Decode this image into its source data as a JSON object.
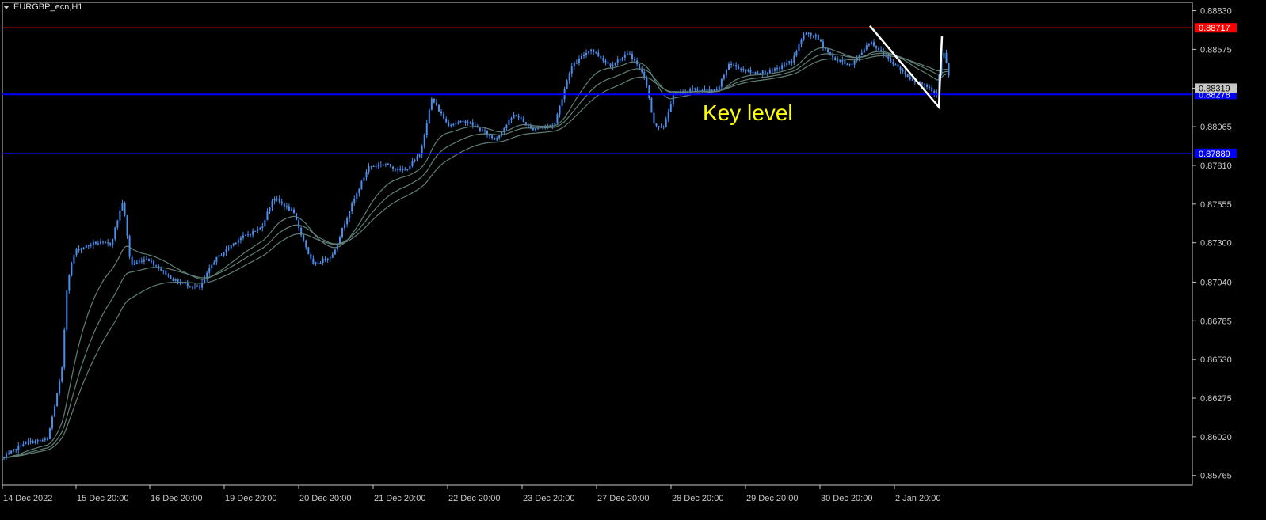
{
  "window": {
    "symbol_title": "EURGBP_ecn,H1"
  },
  "colors": {
    "background": "#000000",
    "axis": "#c8c8c8",
    "candle": "#4a8ef0",
    "ma": "#5f7f78",
    "resistance": "#ff0000",
    "key_level": "#0000ff",
    "support": "#0000ff",
    "annotation": "#ffff00",
    "trend_line": "#ffffff"
  },
  "chart_data": {
    "type": "candlestick",
    "symbol": "EURGBP_ecn",
    "timeframe": "H1",
    "y_range": [
      0.85701,
      0.88885
    ],
    "price_ticks": [
      "0.88830",
      "0.88575",
      "0.88319",
      "0.88065",
      "0.87810",
      "0.87555",
      "0.87300",
      "0.87040",
      "0.86785",
      "0.86530",
      "0.86275",
      "0.86020",
      "0.85765"
    ],
    "time_labels": [
      "14 Dec 2022",
      "15 Dec 20:00",
      "16 Dec 20:00",
      "19 Dec 20:00",
      "20 Dec 20:00",
      "21 Dec 20:00",
      "22 Dec 20:00",
      "23 Dec 20:00",
      "27 Dec 20:00",
      "28 Dec 20:00",
      "29 Dec 20:00",
      "30 Dec 20:00",
      "2 Jan 20:00"
    ],
    "horizontal_lines": [
      {
        "name": "resistance",
        "price": 0.88717,
        "label": "0.88717",
        "color": "#ff0000"
      },
      {
        "name": "key-level",
        "price": 0.88278,
        "label": "0.88278",
        "color": "#0000ff"
      },
      {
        "name": "support",
        "price": 0.87889,
        "label": "0.87889",
        "color": "#0000ff"
      }
    ],
    "current_price": {
      "price": 0.88319,
      "label": "0.88319"
    },
    "annotation": {
      "text": "Key level",
      "price": 0.8815
    },
    "trend_line": {
      "from_price": 0.8873,
      "to_price": 0.88195,
      "return_price": 0.8866
    },
    "price_path": [
      {
        "x": 0,
        "y": 0.8586
      },
      {
        "x": 30,
        "y": 0.8598
      },
      {
        "x": 60,
        "y": 0.86
      },
      {
        "x": 78,
        "y": 0.8645
      },
      {
        "x": 85,
        "y": 0.8705
      },
      {
        "x": 95,
        "y": 0.8725
      },
      {
        "x": 120,
        "y": 0.873
      },
      {
        "x": 140,
        "y": 0.8729
      },
      {
        "x": 155,
        "y": 0.8758
      },
      {
        "x": 165,
        "y": 0.8715
      },
      {
        "x": 185,
        "y": 0.872
      },
      {
        "x": 220,
        "y": 0.8705
      },
      {
        "x": 252,
        "y": 0.87
      },
      {
        "x": 270,
        "y": 0.8718
      },
      {
        "x": 300,
        "y": 0.8732
      },
      {
        "x": 330,
        "y": 0.874
      },
      {
        "x": 345,
        "y": 0.876
      },
      {
        "x": 370,
        "y": 0.875
      },
      {
        "x": 395,
        "y": 0.8715
      },
      {
        "x": 420,
        "y": 0.8722
      },
      {
        "x": 440,
        "y": 0.875
      },
      {
        "x": 465,
        "y": 0.878
      },
      {
        "x": 485,
        "y": 0.8782
      },
      {
        "x": 510,
        "y": 0.8777
      },
      {
        "x": 530,
        "y": 0.8788
      },
      {
        "x": 545,
        "y": 0.8825
      },
      {
        "x": 565,
        "y": 0.8808
      },
      {
        "x": 590,
        "y": 0.881
      },
      {
        "x": 625,
        "y": 0.8798
      },
      {
        "x": 650,
        "y": 0.8815
      },
      {
        "x": 670,
        "y": 0.8805
      },
      {
        "x": 700,
        "y": 0.8808
      },
      {
        "x": 720,
        "y": 0.8845
      },
      {
        "x": 745,
        "y": 0.8858
      },
      {
        "x": 770,
        "y": 0.8847
      },
      {
        "x": 795,
        "y": 0.8855
      },
      {
        "x": 815,
        "y": 0.8838
      },
      {
        "x": 825,
        "y": 0.8808
      },
      {
        "x": 838,
        "y": 0.8806
      },
      {
        "x": 850,
        "y": 0.8828
      },
      {
        "x": 875,
        "y": 0.8831
      },
      {
        "x": 905,
        "y": 0.883
      },
      {
        "x": 920,
        "y": 0.8848
      },
      {
        "x": 950,
        "y": 0.8842
      },
      {
        "x": 975,
        "y": 0.8843
      },
      {
        "x": 1000,
        "y": 0.885
      },
      {
        "x": 1015,
        "y": 0.8868
      },
      {
        "x": 1030,
        "y": 0.8866
      },
      {
        "x": 1050,
        "y": 0.8852
      },
      {
        "x": 1075,
        "y": 0.8847
      },
      {
        "x": 1098,
        "y": 0.8863
      },
      {
        "x": 1120,
        "y": 0.8852
      },
      {
        "x": 1150,
        "y": 0.8838
      },
      {
        "x": 1175,
        "y": 0.8832
      },
      {
        "x": 1182,
        "y": 0.8827
      },
      {
        "x": 1190,
        "y": 0.8858
      },
      {
        "x": 1200,
        "y": 0.8835
      }
    ]
  }
}
